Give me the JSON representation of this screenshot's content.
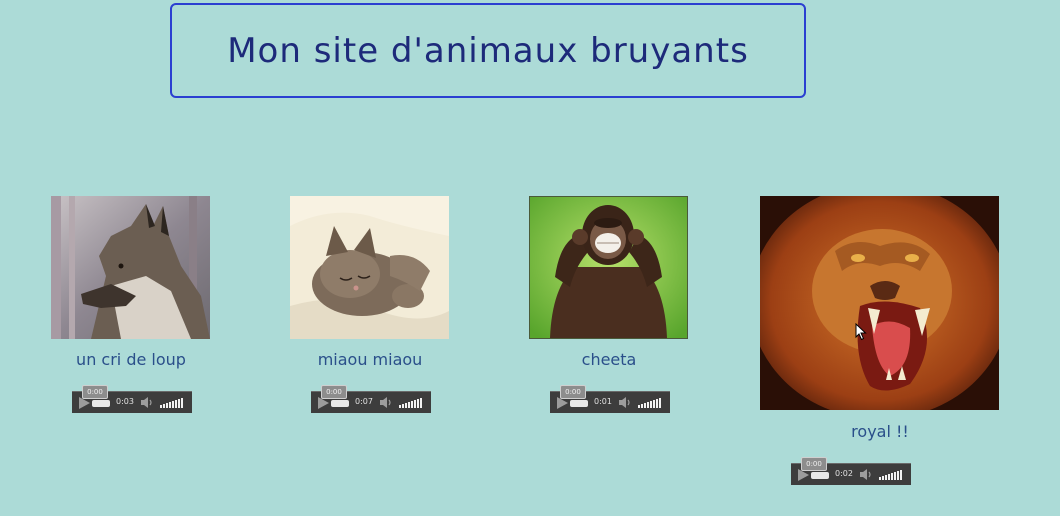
{
  "page": {
    "title": "Mon site d'animaux bruyants"
  },
  "animals": [
    {
      "caption": "un cri de loup",
      "player": {
        "tooltip": "0:00",
        "duration": "0:03"
      }
    },
    {
      "caption": "miaou miaou",
      "player": {
        "tooltip": "0:00",
        "duration": "0:07"
      }
    },
    {
      "caption": "cheeta",
      "player": {
        "tooltip": "0:00",
        "duration": "0:01"
      }
    },
    {
      "caption": "royal !!",
      "player": {
        "tooltip": "0:00",
        "duration": "0:02"
      }
    }
  ],
  "icons": {
    "play": "play-icon",
    "volume": "volume-icon",
    "volume_level": "volume-level-bars"
  },
  "colors": {
    "background": "#acdbd7",
    "title_border": "#2b3fd1",
    "title_text": "#1d2a7a",
    "caption_text": "#2a4f8a",
    "player_bg": "#3d3d3d"
  }
}
